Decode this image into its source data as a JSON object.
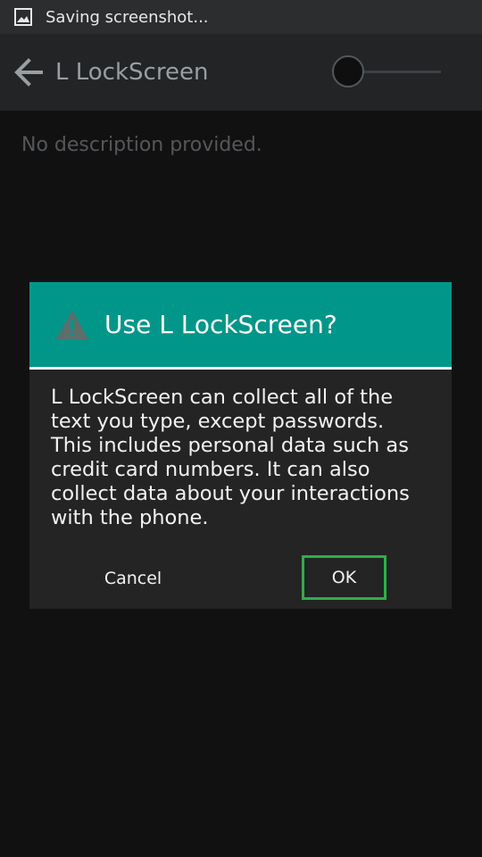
{
  "status_bar": {
    "text": "Saving screenshot...",
    "icon": "image-icon"
  },
  "action_bar": {
    "title": "L LockScreen",
    "back_icon": "back-arrow-icon",
    "toggle_state": "off"
  },
  "content": {
    "description": "No description provided."
  },
  "dialog": {
    "title": "Use L LockScreen?",
    "icon": "warning-icon",
    "header_color": "#009689",
    "body": "L LockScreen can collect all of the text you type, except passwords. This includes personal data such as credit card numbers. It can also collect data about your interactions with the phone.",
    "cancel_label": "Cancel",
    "ok_label": "OK",
    "ok_highlight_color": "#2fae49"
  }
}
